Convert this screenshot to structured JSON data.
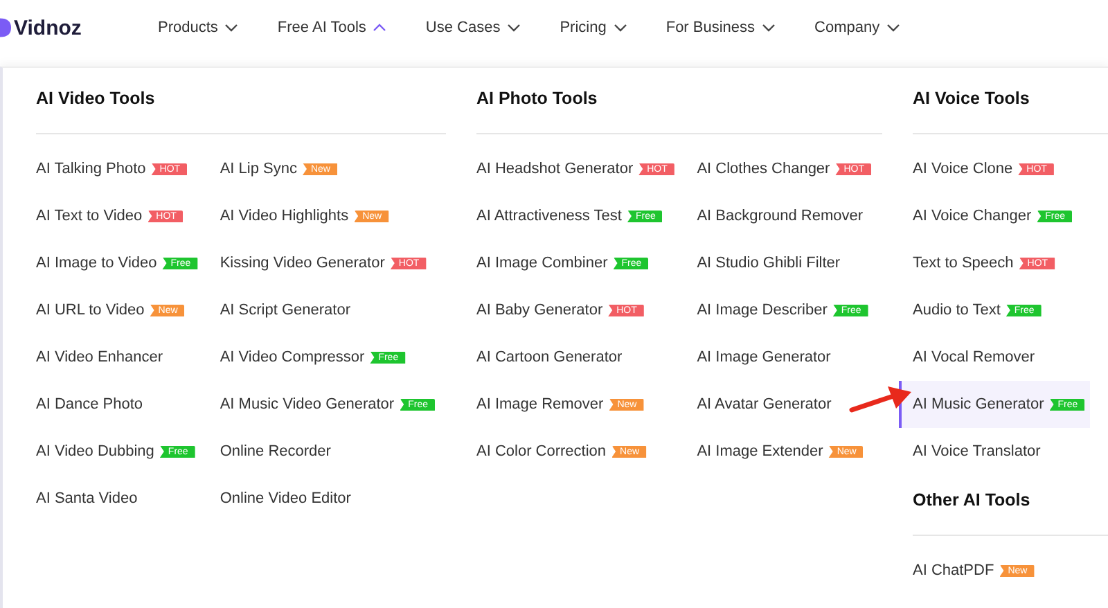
{
  "brand": "Vidnoz",
  "nav": [
    {
      "label": "Products",
      "expanded": false
    },
    {
      "label": "Free AI Tools",
      "expanded": true
    },
    {
      "label": "Use Cases",
      "expanded": false
    },
    {
      "label": "Pricing",
      "expanded": false
    },
    {
      "label": "For Business",
      "expanded": false
    },
    {
      "label": "Company",
      "expanded": false
    }
  ],
  "sections": [
    {
      "title": "AI Video Tools",
      "columns": [
        [
          {
            "label": "AI Talking Photo",
            "selected": false,
            "badge": {
              "kind": "hot",
              "text": "HOT"
            }
          },
          {
            "label": "AI Text to Video",
            "selected": false,
            "badge": {
              "kind": "hot",
              "text": "HOT"
            }
          },
          {
            "label": "AI Image to Video",
            "selected": false,
            "badge": {
              "kind": "free",
              "text": "Free"
            }
          },
          {
            "label": "AI URL to Video",
            "selected": false,
            "badge": {
              "kind": "new",
              "text": "New"
            }
          },
          {
            "label": "AI Video Enhancer",
            "selected": false
          },
          {
            "label": "AI Dance Photo",
            "selected": false
          },
          {
            "label": "AI Video Dubbing",
            "selected": false,
            "badge": {
              "kind": "free",
              "text": "Free"
            }
          },
          {
            "label": "AI Santa Video",
            "selected": false
          }
        ],
        [
          {
            "label": "AI Lip Sync",
            "selected": false,
            "badge": {
              "kind": "new",
              "text": "New"
            }
          },
          {
            "label": "AI Video Highlights",
            "selected": false,
            "badge": {
              "kind": "new",
              "text": "New"
            }
          },
          {
            "label": "Kissing Video Generator",
            "selected": false,
            "badge": {
              "kind": "hot",
              "text": "HOT"
            }
          },
          {
            "label": "AI Script Generator",
            "selected": false
          },
          {
            "label": "AI Video Compressor",
            "selected": false,
            "badge": {
              "kind": "free",
              "text": "Free"
            }
          },
          {
            "label": "AI Music Video Generator",
            "selected": false,
            "badge": {
              "kind": "free",
              "text": "Free"
            }
          },
          {
            "label": "Online Recorder",
            "selected": false
          },
          {
            "label": "Online Video Editor",
            "selected": false
          }
        ]
      ]
    },
    {
      "title": "AI Photo Tools",
      "columns": [
        [
          {
            "label": "AI Headshot Generator",
            "selected": false,
            "badge": {
              "kind": "hot",
              "text": "HOT"
            }
          },
          {
            "label": "AI Attractiveness Test",
            "selected": false,
            "badge": {
              "kind": "free",
              "text": "Free"
            }
          },
          {
            "label": "AI Image Combiner",
            "selected": false,
            "badge": {
              "kind": "free",
              "text": "Free"
            }
          },
          {
            "label": "AI Baby Generator",
            "selected": false,
            "badge": {
              "kind": "hot",
              "text": "HOT"
            }
          },
          {
            "label": "AI Cartoon Generator",
            "selected": false
          },
          {
            "label": "AI Image Remover",
            "selected": false,
            "badge": {
              "kind": "new",
              "text": "New"
            }
          },
          {
            "label": "AI Color Correction",
            "selected": false,
            "badge": {
              "kind": "new",
              "text": "New"
            }
          }
        ],
        [
          {
            "label": "AI Clothes Changer",
            "selected": false,
            "badge": {
              "kind": "hot",
              "text": "HOT"
            }
          },
          {
            "label": "AI Background Remover",
            "selected": false
          },
          {
            "label": "AI Studio Ghibli Filter",
            "selected": false
          },
          {
            "label": "AI Image Describer",
            "selected": false,
            "badge": {
              "kind": "free",
              "text": "Free"
            }
          },
          {
            "label": "AI Image Generator",
            "selected": false
          },
          {
            "label": "AI Avatar Generator",
            "selected": false
          },
          {
            "label": "AI Image Extender",
            "selected": false,
            "badge": {
              "kind": "new",
              "text": "New"
            }
          }
        ]
      ]
    },
    {
      "title": "AI Voice Tools",
      "columns": [
        [
          {
            "label": "AI Voice Clone",
            "selected": false,
            "badge": {
              "kind": "hot",
              "text": "HOT"
            }
          },
          {
            "label": "AI Voice Changer",
            "selected": false,
            "badge": {
              "kind": "free",
              "text": "Free"
            }
          },
          {
            "label": "Text to Speech",
            "selected": false,
            "badge": {
              "kind": "hot",
              "text": "HOT"
            }
          },
          {
            "label": "Audio to Text",
            "selected": false,
            "badge": {
              "kind": "free",
              "text": "Free"
            }
          },
          {
            "label": "AI Vocal Remover",
            "selected": false
          },
          {
            "label": "AI Music Generator",
            "selected": true,
            "badge": {
              "kind": "free",
              "text": "Free"
            }
          },
          {
            "label": "AI Voice Translator",
            "selected": false
          }
        ]
      ]
    },
    {
      "title": "Other AI Tools",
      "columns": [
        [
          {
            "label": "AI ChatPDF",
            "selected": false,
            "badge": {
              "kind": "new",
              "text": "New"
            }
          }
        ]
      ]
    }
  ]
}
